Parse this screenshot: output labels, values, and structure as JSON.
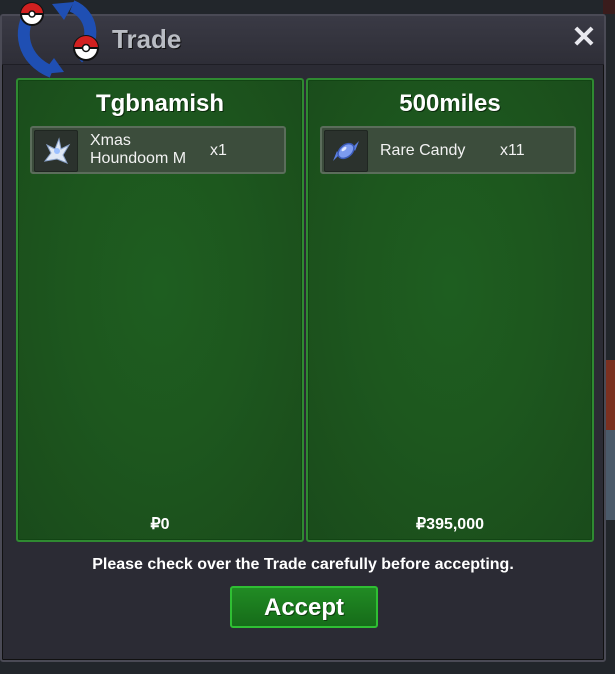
{
  "window": {
    "title": "Trade"
  },
  "left_panel": {
    "name": "Tgbnamish",
    "items": [
      {
        "name_line1": "Xmas",
        "name_line2": "Houndoom M",
        "qty": "x1",
        "icon": "xmas-houndoom-sprite-icon"
      }
    ],
    "money": "₽0"
  },
  "right_panel": {
    "name": "500miles",
    "items": [
      {
        "name": "Rare Candy",
        "qty": "x11",
        "icon": "rare-candy-icon"
      }
    ],
    "money": "₽395,000"
  },
  "notice": "Please check over the Trade carefully before accepting.",
  "accept_label": "Accept",
  "colors": {
    "panel_green": "#1d571e",
    "panel_border": "#2f8a31",
    "window_bg": "#2b2b34",
    "accept_green": "#1f821f"
  }
}
